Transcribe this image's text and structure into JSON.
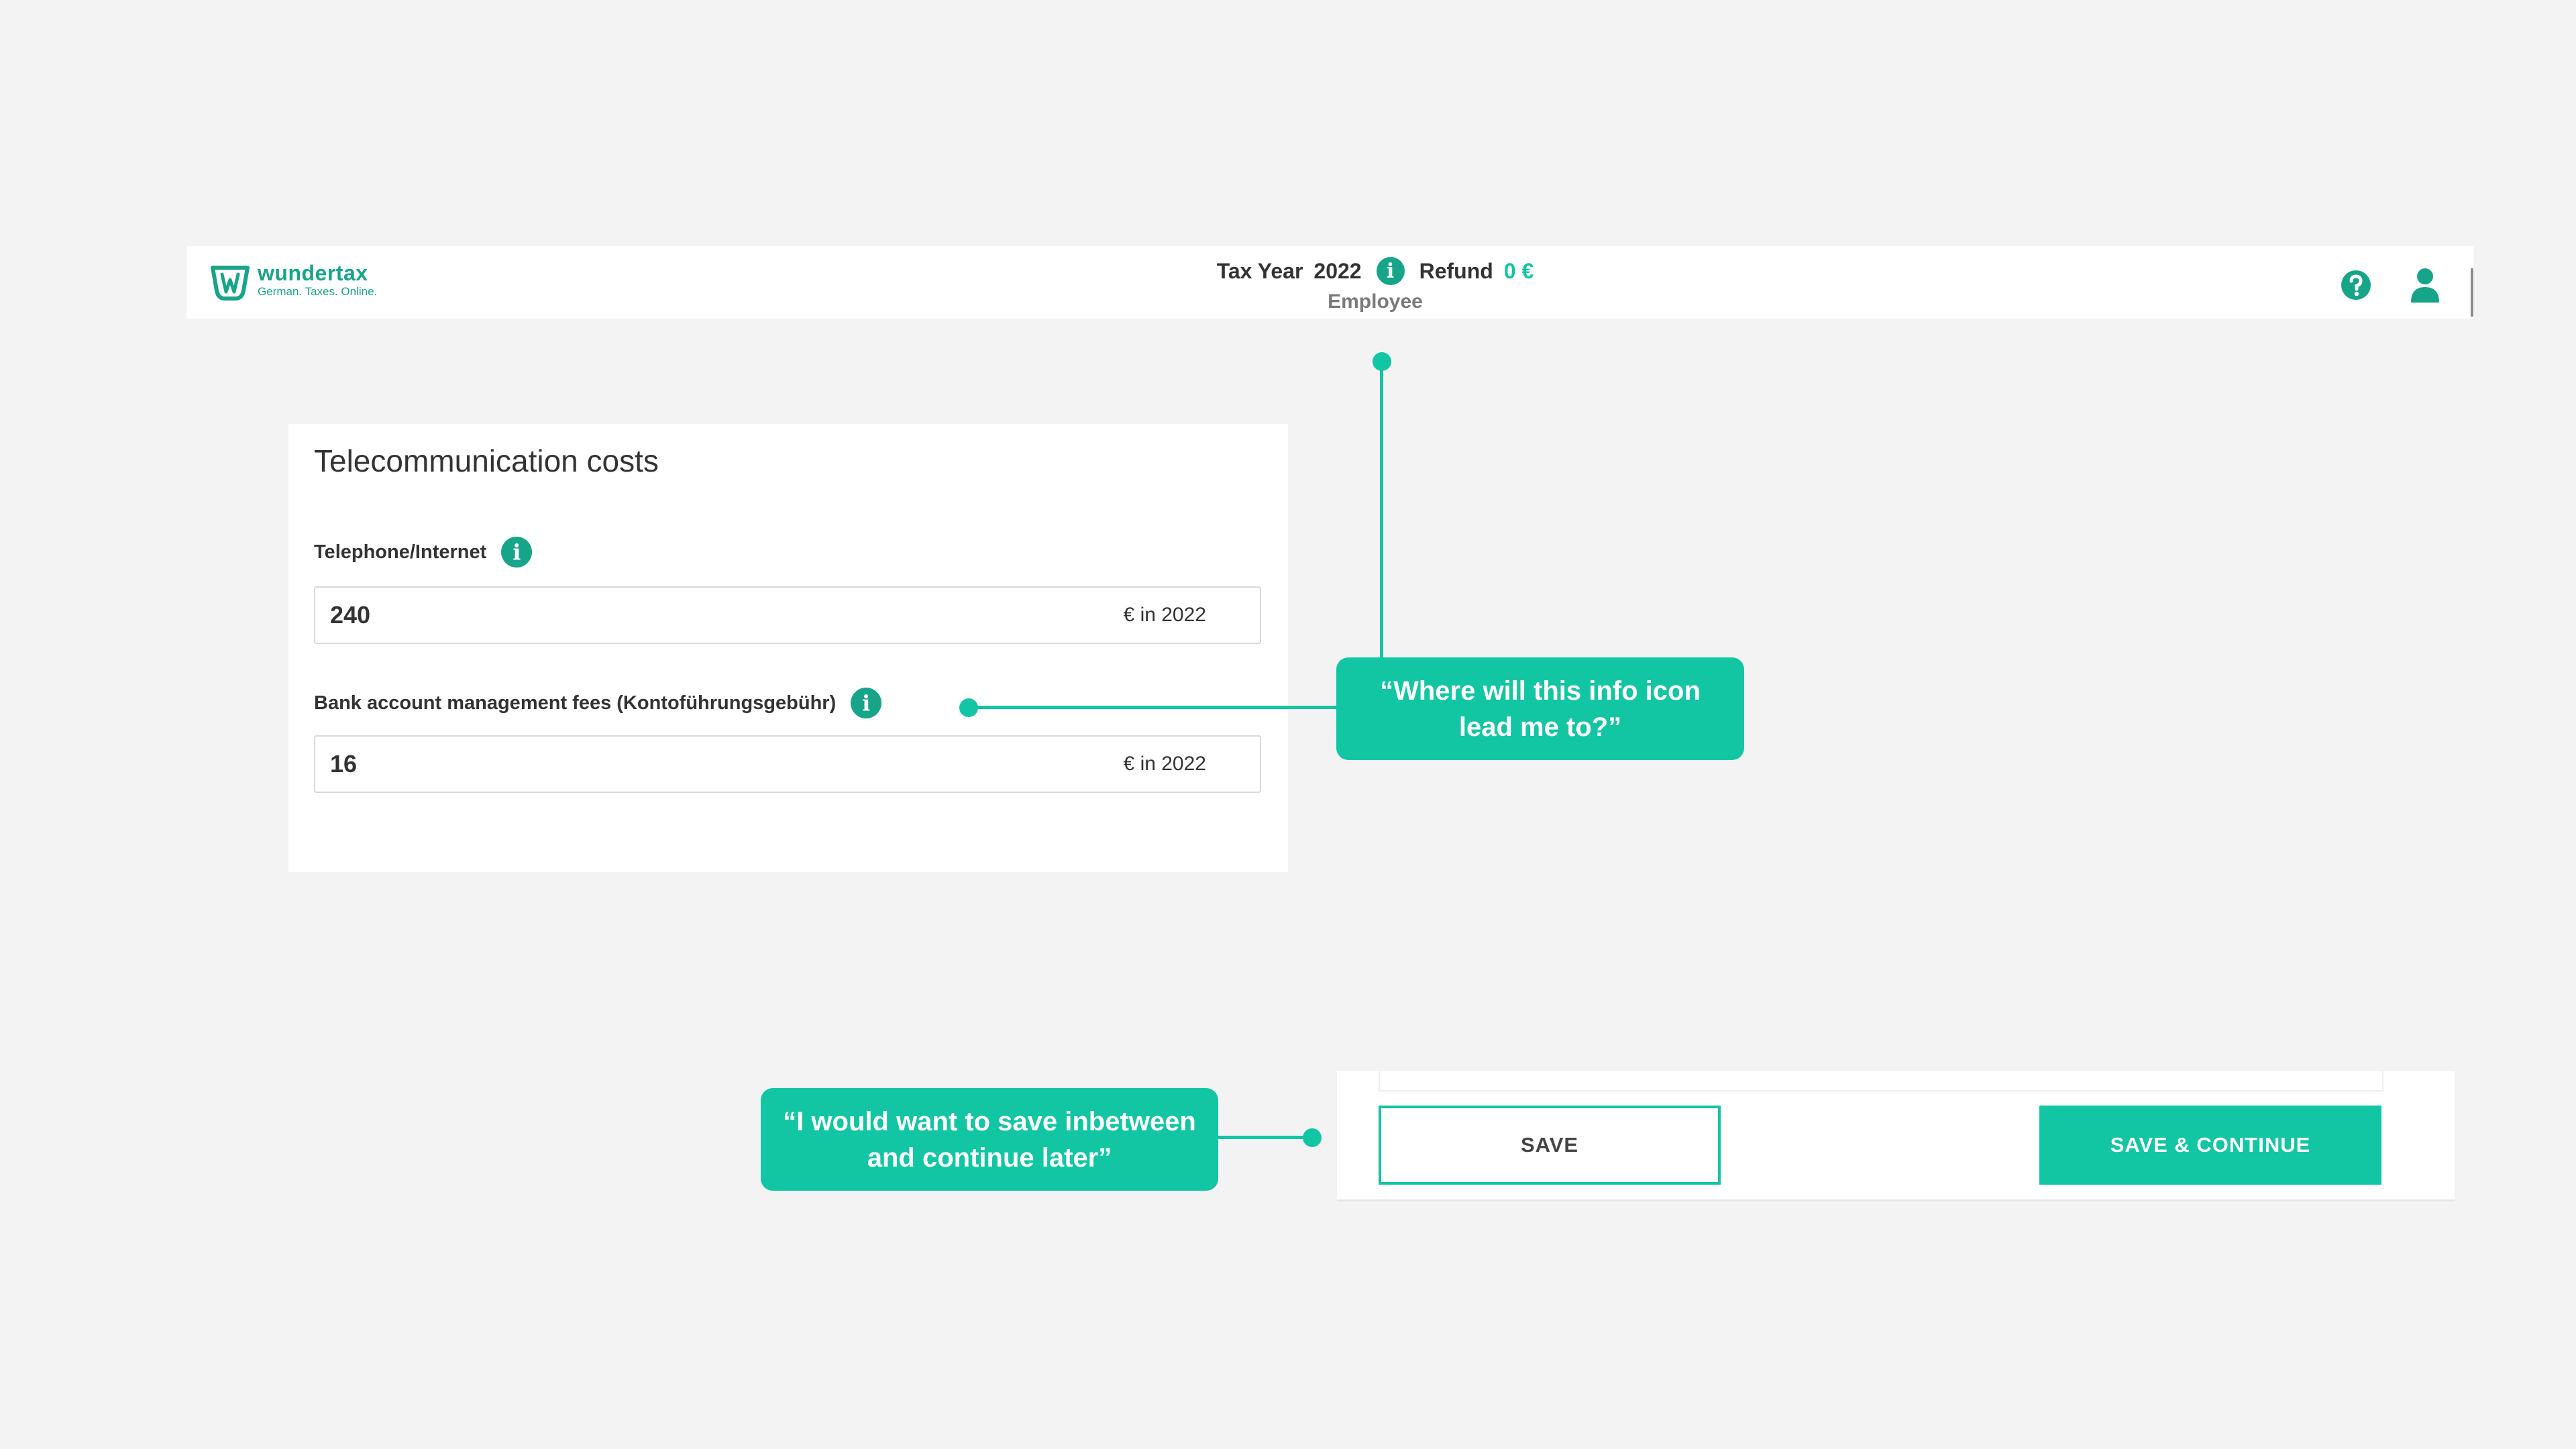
{
  "header": {
    "brand_name": "wundertax",
    "brand_tagline": "German. Taxes. Online.",
    "tax_year_label": "Tax Year",
    "tax_year_value": "2022",
    "refund_label": "Refund",
    "refund_value": "0 €",
    "role": "Employee",
    "info_glyph": "i",
    "icons": [
      "wundertax-logo-icon",
      "info-icon",
      "help-icon",
      "user-icon"
    ]
  },
  "card": {
    "title": "Telecommunication costs",
    "fields": [
      {
        "label": "Telephone/Internet",
        "value": "240",
        "suffix": "€ in 2022"
      },
      {
        "label": "Bank account management fees (Kontoführungsgebühr)",
        "value": "16",
        "suffix": "€ in 2022"
      }
    ]
  },
  "actions": {
    "save_label": "SAVE",
    "save_continue_label": "SAVE & CONTINUE"
  },
  "annotations": {
    "info_icon_note": "“Where will this info icon lead me to?”",
    "save_note": "“I would want to save inbetween and continue later”"
  },
  "colors": {
    "accent": "#12c6a3",
    "brand": "#17a589",
    "background": "#f3f3f3"
  }
}
